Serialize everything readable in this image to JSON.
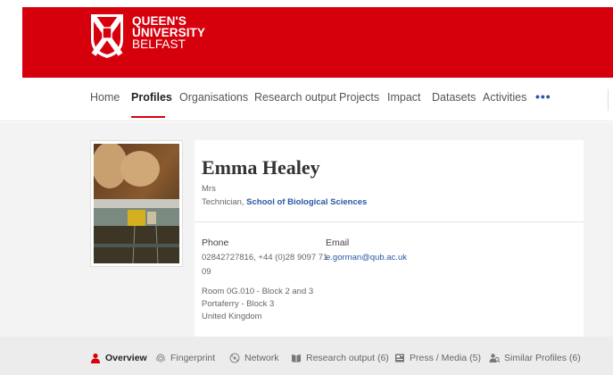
{
  "header": {
    "logo_lines": [
      "QUEEN'S",
      "UNIVERSITY",
      "BELFAST"
    ],
    "brand_color": "#d6000d"
  },
  "nav": {
    "items": [
      {
        "label": "Home"
      },
      {
        "label": "Profiles",
        "active": true
      },
      {
        "label": "Organisations"
      },
      {
        "label": "Research output"
      },
      {
        "label": "Projects"
      },
      {
        "label": "Impact"
      },
      {
        "label": "Datasets"
      },
      {
        "label": "Activities"
      }
    ],
    "more_label": "•••"
  },
  "profile": {
    "name": "Emma Healey",
    "title": "Mrs",
    "role_prefix": "Technician, ",
    "department": "School of Biological Sciences",
    "phone_label": "Phone",
    "phone_line1": "02842727816, +44 (0)28 9097 71",
    "phone_line2": "09",
    "email_label": "Email",
    "email": "e.gorman@qub.ac.uk",
    "address": [
      "Room 0G.010 - Block 2 and 3",
      "Portaferry - Block 3",
      "United Kingdom"
    ]
  },
  "tabs": [
    {
      "label": "Overview",
      "icon": "person-icon",
      "active": true
    },
    {
      "label": "Fingerprint",
      "icon": "fingerprint-icon"
    },
    {
      "label": "Network",
      "icon": "network-icon"
    },
    {
      "label": "Research output (6)",
      "icon": "book-icon"
    },
    {
      "label": "Press / Media (5)",
      "icon": "newspaper-icon"
    },
    {
      "label": "Similar Profiles (6)",
      "icon": "similar-people-icon"
    }
  ],
  "colors": {
    "link": "#2a57a5",
    "active_tab_icon": "#d6000d"
  }
}
